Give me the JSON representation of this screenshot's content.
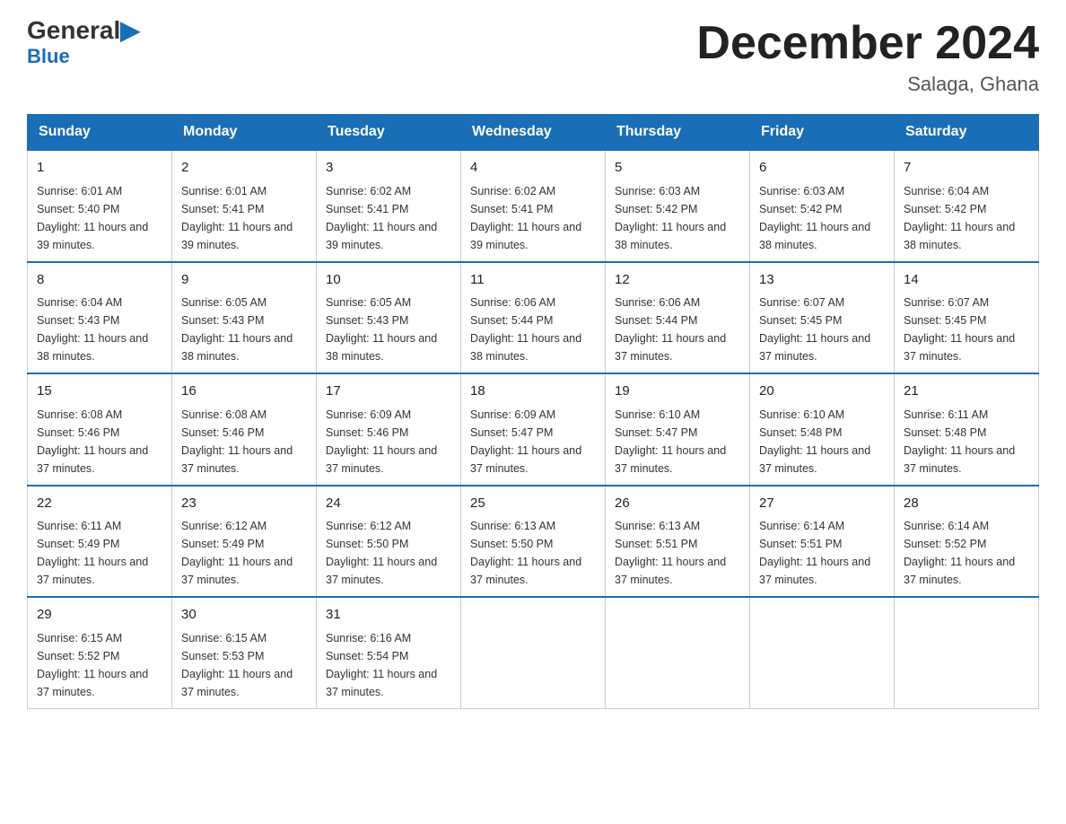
{
  "logo": {
    "general": "General",
    "blue": "Blue"
  },
  "title": {
    "month_year": "December 2024",
    "location": "Salaga, Ghana"
  },
  "headers": [
    "Sunday",
    "Monday",
    "Tuesday",
    "Wednesday",
    "Thursday",
    "Friday",
    "Saturday"
  ],
  "weeks": [
    [
      {
        "day": "1",
        "sunrise": "6:01 AM",
        "sunset": "5:40 PM",
        "daylight": "11 hours and 39 minutes."
      },
      {
        "day": "2",
        "sunrise": "6:01 AM",
        "sunset": "5:41 PM",
        "daylight": "11 hours and 39 minutes."
      },
      {
        "day": "3",
        "sunrise": "6:02 AM",
        "sunset": "5:41 PM",
        "daylight": "11 hours and 39 minutes."
      },
      {
        "day": "4",
        "sunrise": "6:02 AM",
        "sunset": "5:41 PM",
        "daylight": "11 hours and 39 minutes."
      },
      {
        "day": "5",
        "sunrise": "6:03 AM",
        "sunset": "5:42 PM",
        "daylight": "11 hours and 38 minutes."
      },
      {
        "day": "6",
        "sunrise": "6:03 AM",
        "sunset": "5:42 PM",
        "daylight": "11 hours and 38 minutes."
      },
      {
        "day": "7",
        "sunrise": "6:04 AM",
        "sunset": "5:42 PM",
        "daylight": "11 hours and 38 minutes."
      }
    ],
    [
      {
        "day": "8",
        "sunrise": "6:04 AM",
        "sunset": "5:43 PM",
        "daylight": "11 hours and 38 minutes."
      },
      {
        "day": "9",
        "sunrise": "6:05 AM",
        "sunset": "5:43 PM",
        "daylight": "11 hours and 38 minutes."
      },
      {
        "day": "10",
        "sunrise": "6:05 AM",
        "sunset": "5:43 PM",
        "daylight": "11 hours and 38 minutes."
      },
      {
        "day": "11",
        "sunrise": "6:06 AM",
        "sunset": "5:44 PM",
        "daylight": "11 hours and 38 minutes."
      },
      {
        "day": "12",
        "sunrise": "6:06 AM",
        "sunset": "5:44 PM",
        "daylight": "11 hours and 37 minutes."
      },
      {
        "day": "13",
        "sunrise": "6:07 AM",
        "sunset": "5:45 PM",
        "daylight": "11 hours and 37 minutes."
      },
      {
        "day": "14",
        "sunrise": "6:07 AM",
        "sunset": "5:45 PM",
        "daylight": "11 hours and 37 minutes."
      }
    ],
    [
      {
        "day": "15",
        "sunrise": "6:08 AM",
        "sunset": "5:46 PM",
        "daylight": "11 hours and 37 minutes."
      },
      {
        "day": "16",
        "sunrise": "6:08 AM",
        "sunset": "5:46 PM",
        "daylight": "11 hours and 37 minutes."
      },
      {
        "day": "17",
        "sunrise": "6:09 AM",
        "sunset": "5:46 PM",
        "daylight": "11 hours and 37 minutes."
      },
      {
        "day": "18",
        "sunrise": "6:09 AM",
        "sunset": "5:47 PM",
        "daylight": "11 hours and 37 minutes."
      },
      {
        "day": "19",
        "sunrise": "6:10 AM",
        "sunset": "5:47 PM",
        "daylight": "11 hours and 37 minutes."
      },
      {
        "day": "20",
        "sunrise": "6:10 AM",
        "sunset": "5:48 PM",
        "daylight": "11 hours and 37 minutes."
      },
      {
        "day": "21",
        "sunrise": "6:11 AM",
        "sunset": "5:48 PM",
        "daylight": "11 hours and 37 minutes."
      }
    ],
    [
      {
        "day": "22",
        "sunrise": "6:11 AM",
        "sunset": "5:49 PM",
        "daylight": "11 hours and 37 minutes."
      },
      {
        "day": "23",
        "sunrise": "6:12 AM",
        "sunset": "5:49 PM",
        "daylight": "11 hours and 37 minutes."
      },
      {
        "day": "24",
        "sunrise": "6:12 AM",
        "sunset": "5:50 PM",
        "daylight": "11 hours and 37 minutes."
      },
      {
        "day": "25",
        "sunrise": "6:13 AM",
        "sunset": "5:50 PM",
        "daylight": "11 hours and 37 minutes."
      },
      {
        "day": "26",
        "sunrise": "6:13 AM",
        "sunset": "5:51 PM",
        "daylight": "11 hours and 37 minutes."
      },
      {
        "day": "27",
        "sunrise": "6:14 AM",
        "sunset": "5:51 PM",
        "daylight": "11 hours and 37 minutes."
      },
      {
        "day": "28",
        "sunrise": "6:14 AM",
        "sunset": "5:52 PM",
        "daylight": "11 hours and 37 minutes."
      }
    ],
    [
      {
        "day": "29",
        "sunrise": "6:15 AM",
        "sunset": "5:52 PM",
        "daylight": "11 hours and 37 minutes."
      },
      {
        "day": "30",
        "sunrise": "6:15 AM",
        "sunset": "5:53 PM",
        "daylight": "11 hours and 37 minutes."
      },
      {
        "day": "31",
        "sunrise": "6:16 AM",
        "sunset": "5:54 PM",
        "daylight": "11 hours and 37 minutes."
      },
      null,
      null,
      null,
      null
    ]
  ]
}
